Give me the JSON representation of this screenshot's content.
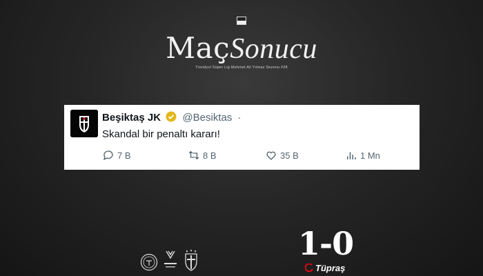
{
  "header": {
    "title_part1": "Maç",
    "title_part2": "Sonucu",
    "subtitle": "Trendyol Süper Lig Mehmet Ali Yılmaz Sezonu #28"
  },
  "tweet": {
    "account_name": "Beşiktaş JK",
    "handle": "@Besiktas",
    "separator": "·",
    "text": "Skandal bir penaltı kararı!",
    "actions": {
      "replies": "7 B",
      "retweets": "8 B",
      "likes": "35 B",
      "views": "1 Mn"
    },
    "colors": {
      "icon": "#536471",
      "verified": "#E2B719"
    }
  },
  "score": "1-0",
  "sponsor": "Tüpraş",
  "logos": [
    "tff-logo",
    "trendyol-superlig-logo",
    "besiktas-crest"
  ],
  "colors": {
    "sponsor_accent": "#E30613",
    "background": "#262626"
  }
}
